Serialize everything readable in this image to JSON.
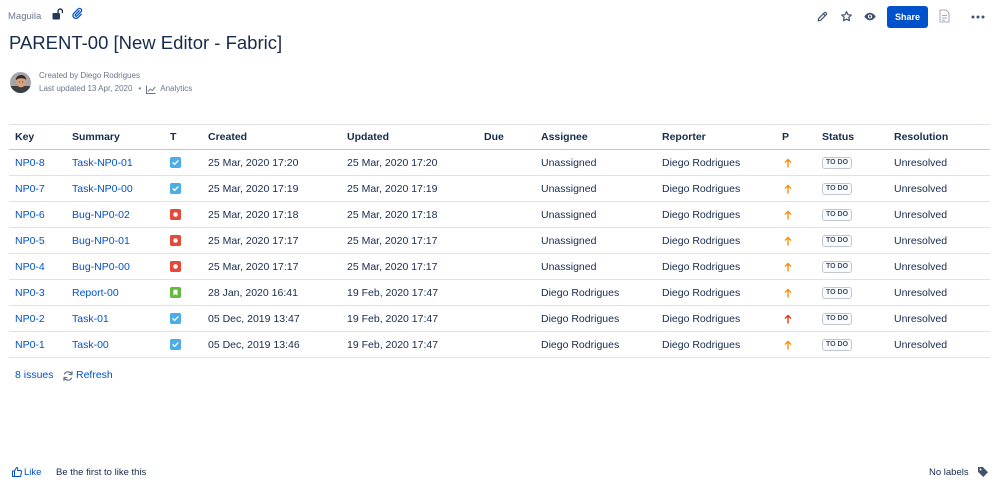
{
  "breadcrumb": {
    "space": "Maguila"
  },
  "toolbar": {
    "share_label": "Share"
  },
  "page": {
    "title": "PARENT-00 [New Editor - Fabric]",
    "byline": {
      "created_by": "Created by Diego Rodrigues",
      "last_updated": "Last updated 13 Apr, 2020",
      "separator": "•",
      "analytics_label": "Analytics"
    }
  },
  "issues_table": {
    "columns": [
      "Key",
      "Summary",
      "T",
      "Created",
      "Updated",
      "Due",
      "Assignee",
      "Reporter",
      "P",
      "Status",
      "Resolution"
    ],
    "rows": [
      {
        "key": "NP0-8",
        "summary": "Task-NP0-01",
        "type_icon": "task-icon",
        "created": "25 Mar, 2020 17:20",
        "updated": "25 Mar, 2020 17:20",
        "assignee": "Unassigned",
        "reporter": "Diego Rodrigues",
        "priority_icon": "priority-medium-icon",
        "status": "TO DO",
        "resolution": "Unresolved"
      },
      {
        "key": "NP0-7",
        "summary": "Task-NP0-00",
        "type_icon": "task-icon",
        "created": "25 Mar, 2020 17:19",
        "updated": "25 Mar, 2020 17:19",
        "assignee": "Unassigned",
        "reporter": "Diego Rodrigues",
        "priority_icon": "priority-medium-icon",
        "status": "TO DO",
        "resolution": "Unresolved"
      },
      {
        "key": "NP0-6",
        "summary": "Bug-NP0-02",
        "type_icon": "bug-icon",
        "created": "25 Mar, 2020 17:18",
        "updated": "25 Mar, 2020 17:18",
        "assignee": "Unassigned",
        "reporter": "Diego Rodrigues",
        "priority_icon": "priority-medium-icon",
        "status": "TO DO",
        "resolution": "Unresolved"
      },
      {
        "key": "NP0-5",
        "summary": "Bug-NP0-01",
        "type_icon": "bug-icon",
        "created": "25 Mar, 2020 17:17",
        "updated": "25 Mar, 2020 17:17",
        "assignee": "Unassigned",
        "reporter": "Diego Rodrigues",
        "priority_icon": "priority-medium-icon",
        "status": "TO DO",
        "resolution": "Unresolved"
      },
      {
        "key": "NP0-4",
        "summary": "Bug-NP0-00",
        "type_icon": "bug-icon",
        "created": "25 Mar, 2020 17:17",
        "updated": "25 Mar, 2020 17:17",
        "assignee": "Unassigned",
        "reporter": "Diego Rodrigues",
        "priority_icon": "priority-medium-icon",
        "status": "TO DO",
        "resolution": "Unresolved"
      },
      {
        "key": "NP0-3",
        "summary": "Report-00",
        "type_icon": "story-icon",
        "created": "28 Jan, 2020 16:41",
        "updated": "19 Feb, 2020 17:47",
        "assignee": "Diego Rodrigues",
        "reporter": "Diego Rodrigues",
        "priority_icon": "priority-medium-icon",
        "status": "TO DO",
        "resolution": "Unresolved"
      },
      {
        "key": "NP0-2",
        "summary": "Task-01",
        "type_icon": "task-icon",
        "created": "05 Dec, 2019 13:47",
        "updated": "19 Feb, 2020 17:47",
        "assignee": "Diego Rodrigues",
        "reporter": "Diego Rodrigues",
        "priority_icon": "priority-high-icon",
        "status": "TO DO",
        "resolution": "Unresolved"
      },
      {
        "key": "NP0-1",
        "summary": "Task-00",
        "type_icon": "task-icon",
        "created": "05 Dec, 2019 13:46",
        "updated": "19 Feb, 2020 17:47",
        "assignee": "Diego Rodrigues",
        "reporter": "Diego Rodrigues",
        "priority_icon": "priority-medium-icon",
        "status": "TO DO",
        "resolution": "Unresolved"
      }
    ],
    "count_label": "8 issues",
    "refresh_label": "Refresh"
  },
  "footer": {
    "like_label": "Like",
    "like_prompt": "Be the first to like this",
    "labels_text": "No labels"
  },
  "icons": {
    "restrictions": "unlocked-padlock-icon",
    "attachments": "paperclip-icon",
    "edit": "pencil-icon",
    "favourite": "star-icon",
    "watch": "eye-icon",
    "document": "document-icon",
    "more": "more-dots-icon",
    "analytics": "line-chart-icon",
    "refresh": "refresh-icon",
    "like": "thumbs-up-icon",
    "labels": "tag-icon"
  },
  "colors": {
    "link": "#0052cc",
    "text": "#172b4d",
    "muted": "#6b778c",
    "share_button": "#0052cc",
    "task_icon": "#4bade8",
    "bug_icon": "#e5493a",
    "story_icon": "#63ba3c",
    "priority_medium": "#ff8b00",
    "priority_high": "#de350b",
    "status_lozenge_text": "#42526e"
  }
}
